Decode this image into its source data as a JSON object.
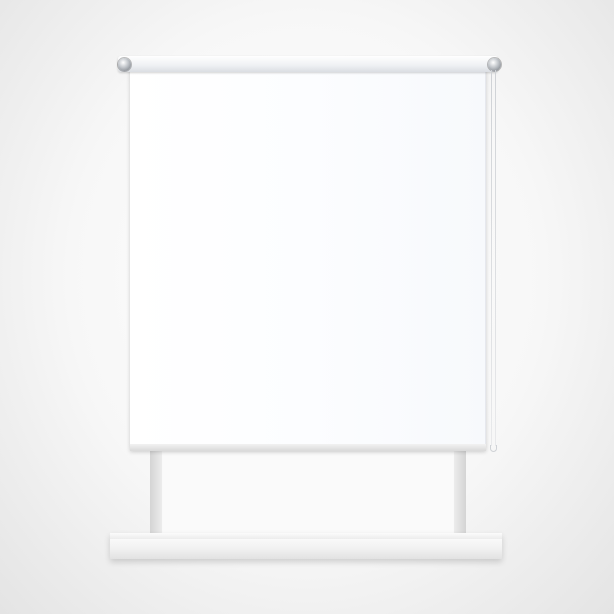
{
  "scene": {
    "blind_color": "#ffffff",
    "sill_color": "#f1f1f1",
    "bracket_color": "#bfc3c8",
    "background_color": "#f7f7f7"
  }
}
